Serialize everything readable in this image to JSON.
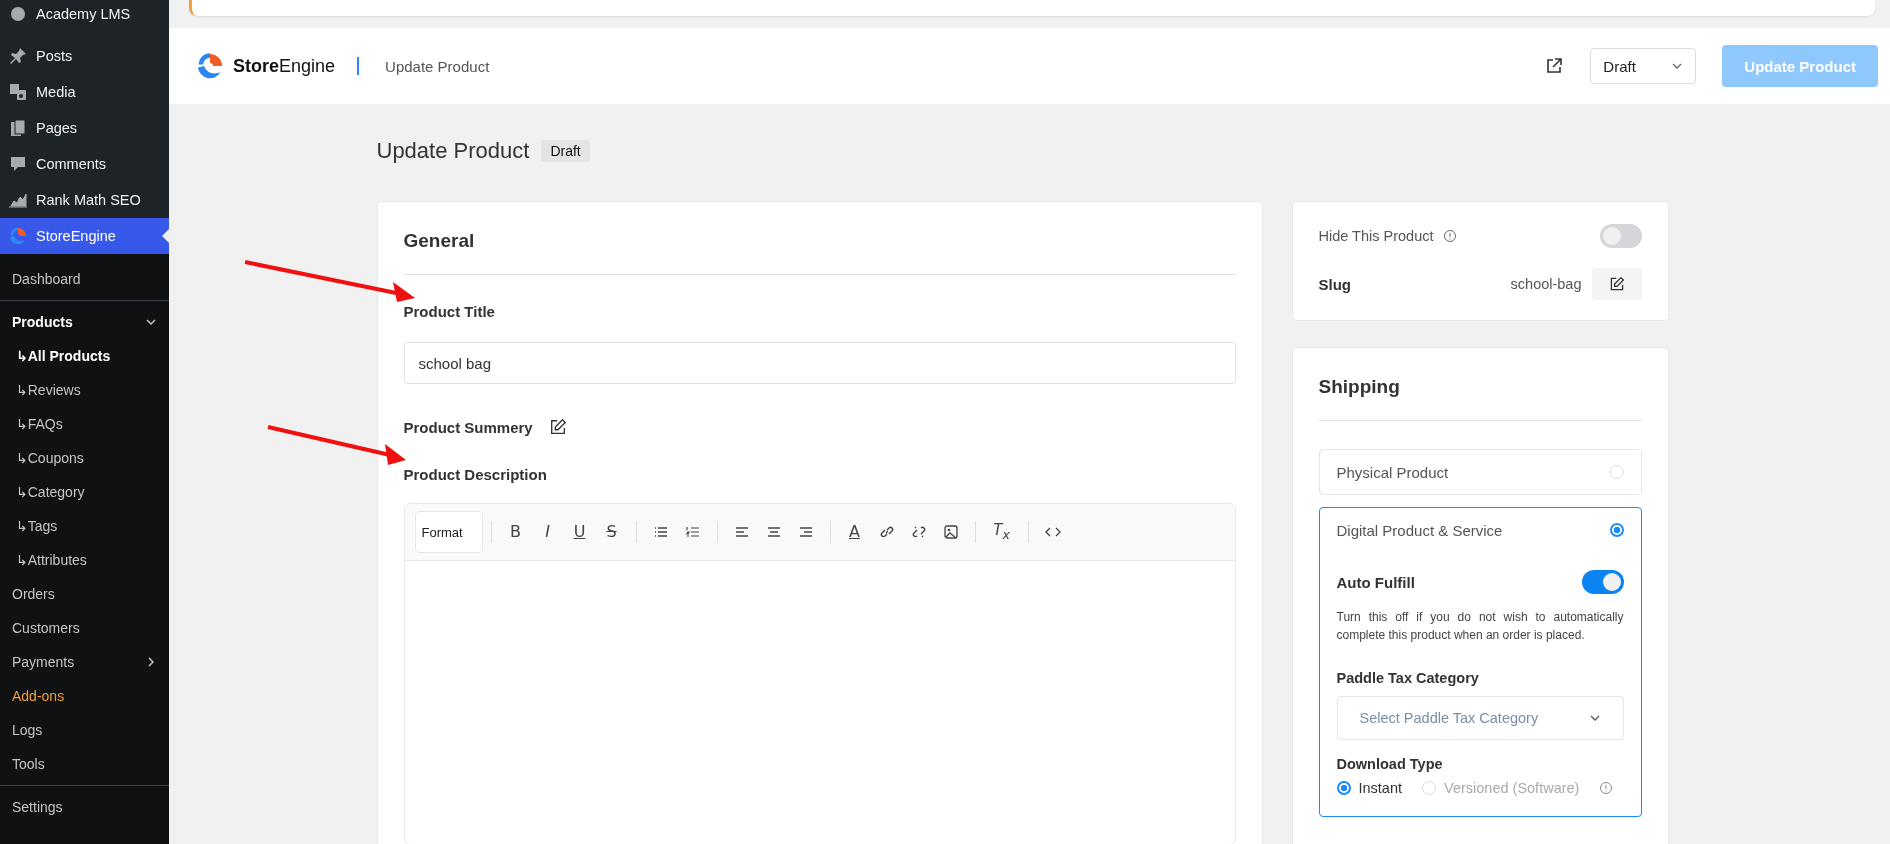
{
  "sidebar": {
    "top_items": [
      {
        "label": "Academy LMS",
        "selected": false
      },
      {
        "label": "Posts",
        "selected": false
      },
      {
        "label": "Media",
        "selected": false
      },
      {
        "label": "Pages",
        "selected": false
      },
      {
        "label": "Comments",
        "selected": false
      },
      {
        "label": "Rank Math SEO",
        "selected": false
      },
      {
        "label": "StoreEngine",
        "selected": true
      }
    ],
    "items": [
      {
        "label": "Dashboard",
        "kind": "plain",
        "selected": false
      },
      {
        "label": "Products",
        "kind": "group",
        "expanded": true
      },
      {
        "label": "All Products",
        "kind": "child",
        "selected": true
      },
      {
        "label": "Reviews",
        "kind": "child",
        "selected": false
      },
      {
        "label": "FAQs",
        "kind": "child",
        "selected": false
      },
      {
        "label": "Coupons",
        "kind": "child",
        "selected": false
      },
      {
        "label": "Category",
        "kind": "child",
        "selected": false
      },
      {
        "label": "Tags",
        "kind": "child",
        "selected": false
      },
      {
        "label": "Attributes",
        "kind": "child",
        "selected": false
      },
      {
        "label": "Orders",
        "kind": "plain",
        "selected": false
      },
      {
        "label": "Customers",
        "kind": "plain",
        "selected": false
      },
      {
        "label": "Payments",
        "kind": "group",
        "expanded": false
      },
      {
        "label": "Add-ons",
        "kind": "promo",
        "selected": false
      },
      {
        "label": "Logs",
        "kind": "plain",
        "selected": false
      },
      {
        "label": "Tools",
        "kind": "plain",
        "selected": false
      }
    ],
    "footer_items": [
      {
        "label": "Settings",
        "selected": false
      }
    ],
    "child_marker": "↳"
  },
  "header": {
    "brand": "**Store**Engine",
    "page": "Update Product",
    "status": "Draft",
    "button": {
      "label": "Update Product",
      "disabled": true
    }
  },
  "title": "Update Product",
  "badge": "Draft",
  "general": {
    "heading": "General",
    "title_label": "Product Title",
    "title_value": "school bag",
    "summary_label": "Product Summery",
    "description_label": "Product Description",
    "toolbar": {
      "format": "Format",
      "groups": [
        [
          {
            "kind": "bold",
            "glyph": "B"
          },
          {
            "kind": "italic",
            "glyph": "I"
          },
          {
            "kind": "underline",
            "glyph": "U"
          },
          {
            "kind": "strike",
            "glyph": "S"
          }
        ],
        [
          {
            "kind": "bullets"
          },
          {
            "kind": "numbers"
          }
        ],
        [
          {
            "kind": "left"
          },
          {
            "kind": "center"
          },
          {
            "kind": "right"
          }
        ],
        [
          {
            "kind": "color",
            "glyph": "A"
          },
          {
            "kind": "link"
          },
          {
            "kind": "unlink"
          },
          {
            "kind": "image"
          }
        ],
        [
          {
            "kind": "clear",
            "glyph": "T$_{x}$"
          }
        ],
        [
          {
            "kind": "code"
          }
        ]
      ]
    }
  },
  "visibility": {
    "hide_label": "Hide This Product",
    "hide_on": false,
    "slug_label": "Slug",
    "slug": "school-bag"
  },
  "shipping": {
    "heading": "Shipping",
    "options": [
      {
        "label": "Physical Product",
        "selected": false
      },
      {
        "label": "Digital Product & Service",
        "selected": true
      }
    ],
    "auto_fulfill": {
      "label": "Auto Fulfill",
      "on": true,
      "help": "Turn this off if you do not wish to automatically complete this product when an order is placed."
    },
    "tax_label": "Paddle Tax Category",
    "tax_placeholder": "Select Paddle Tax Category",
    "download_label": "Download Type",
    "download_types": [
      {
        "label": "Instant",
        "selected": true
      },
      {
        "label": "Versioned (Software)",
        "selected": false
      }
    ]
  }
}
